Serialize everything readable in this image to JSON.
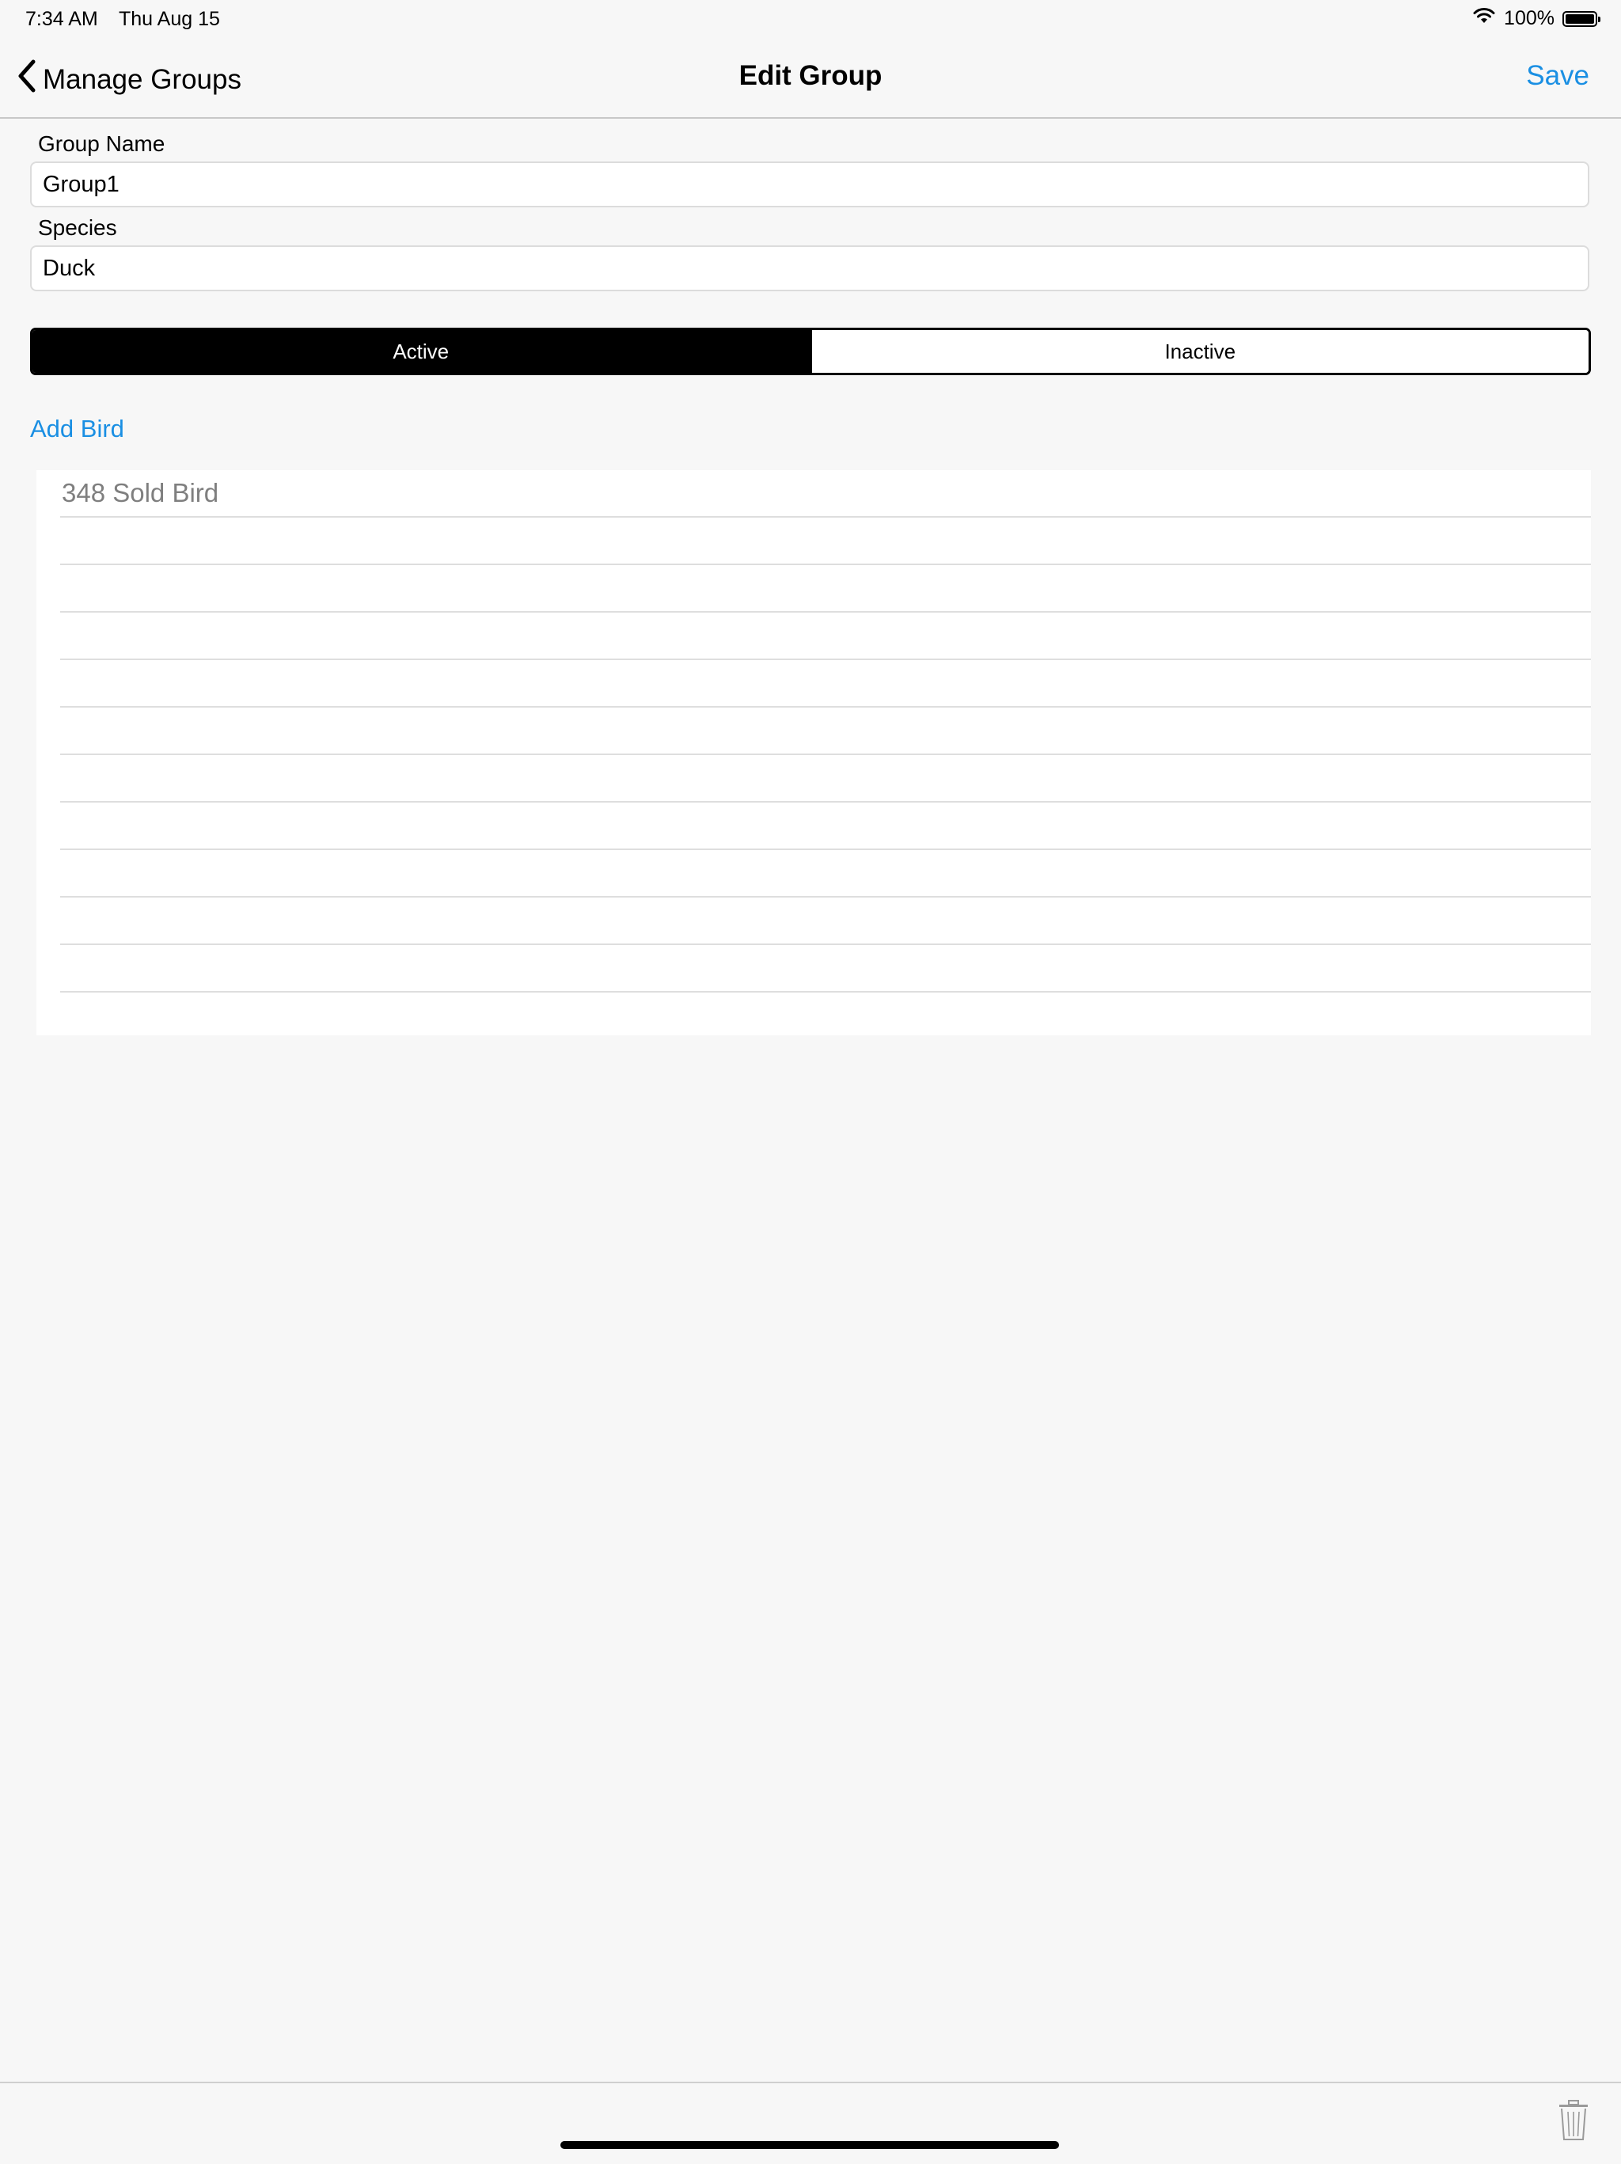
{
  "status_bar": {
    "time": "7:34 AM",
    "date": "Thu Aug 15",
    "battery_text": "100%",
    "battery_level": 1.0
  },
  "nav": {
    "back_label": "Manage Groups",
    "title": "Edit Group",
    "save_label": "Save"
  },
  "form": {
    "group_name_label": "Group Name",
    "group_name_value": "Group1",
    "species_label": "Species",
    "species_value": "Duck"
  },
  "segments": {
    "active_label": "Active",
    "inactive_label": "Inactive",
    "selected": "Active"
  },
  "add_bird_label": "Add Bird",
  "birds": [
    "348 Sold Bird",
    "",
    "",
    "",
    "",
    "",
    "",
    "",
    "",
    "",
    "",
    ""
  ],
  "icons": {
    "back": "chevron-left-icon",
    "wifi": "wifi-icon",
    "battery": "battery-icon",
    "trash": "trash-icon"
  },
  "colors": {
    "accent": "#1a8fe3",
    "background": "#f7f7f7",
    "selected_segment": "#000000"
  }
}
